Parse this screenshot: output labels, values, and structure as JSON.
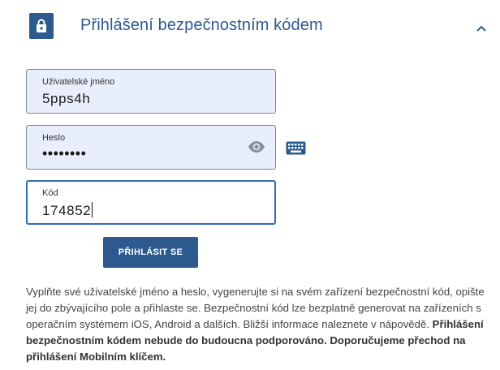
{
  "header": {
    "icon": "lock-icon",
    "title": "Přihlášení bezpečnostním kódem",
    "collapse_icon": "chevron-up-icon"
  },
  "form": {
    "username": {
      "label": "Uživatelské jméno",
      "value": "5pps4h"
    },
    "password": {
      "label": "Heslo",
      "value": "••••••••",
      "reveal_icon": "eye-icon"
    },
    "keyboard_icon": "keyboard-icon",
    "code": {
      "label": "Kód",
      "value": "174852"
    },
    "submit_label": "PŘIHLÁSIT SE"
  },
  "help": {
    "text": "Vyplňte své uživatelské jméno a heslo, vygenerujte si na svém zařízení bezpečnostní kód, opište jej do zbývajícího pole a přihlaste se. Bezpečnostní kód lze bezplatně generovat na zařízeních s operačním systémem iOS, Android a dalších. Bližší informace naleznete v nápovědě.",
    "warning": "Přihlášení bezpečnostním kódem nebude do budoucna podporováno. Doporučujeme přechod na přihlášení Mobilním klíčem."
  },
  "colors": {
    "accent": "#2c5a8f",
    "field_fill": "#e8eefb",
    "active_border": "#2f6db5"
  }
}
